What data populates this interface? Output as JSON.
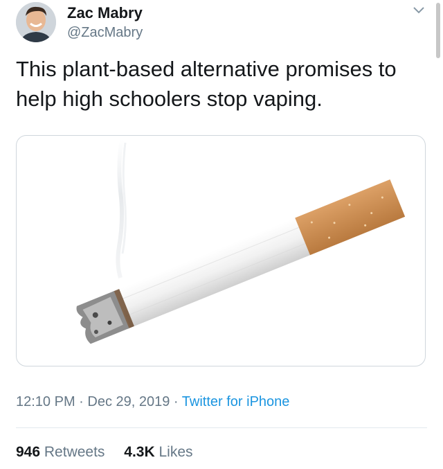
{
  "author": {
    "name": "Zac Mabry",
    "handle": "@ZacMabry"
  },
  "tweet": {
    "text": "This plant-based alternative promises to help high schoolers stop vaping."
  },
  "media": {
    "icon": "cigarette-image"
  },
  "meta": {
    "time": "12:10 PM",
    "separator1": " · ",
    "date": "Dec 29, 2019",
    "separator2": " · ",
    "source": "Twitter for iPhone"
  },
  "stats": {
    "retweets_count": "946",
    "retweets_label": "Retweets",
    "likes_count": "4.3K",
    "likes_label": "Likes"
  },
  "colors": {
    "link": "#1b95e0",
    "secondary_text": "#657786",
    "filter": "#c98a4d"
  }
}
